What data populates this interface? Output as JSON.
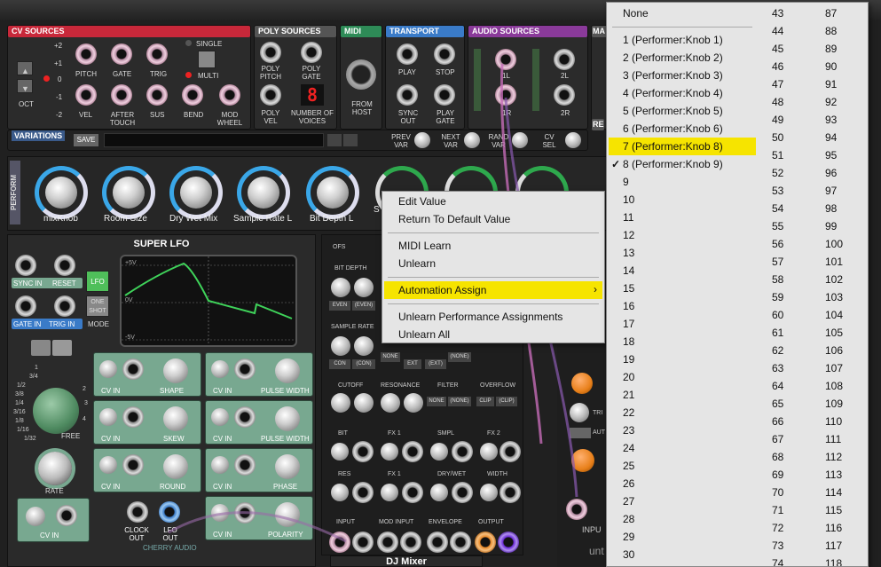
{
  "cv_sources": {
    "title": "CV SOURCES",
    "oct_label": "OCT",
    "oct_values": [
      "+2",
      "+1",
      "0",
      "-1",
      "-2"
    ],
    "jacks": [
      "PITCH",
      "GATE",
      "TRIG",
      "VEL",
      "AFTER TOUCH",
      "SUS",
      "BEND",
      "MOD WHEEL"
    ],
    "single": "SINGLE",
    "multi": "MULTI"
  },
  "poly_sources": {
    "title": "POLY SOURCES",
    "jacks": [
      "POLY PITCH",
      "POLY GATE",
      "POLY VEL",
      "NUMBER OF VOICES"
    ],
    "digit": "8"
  },
  "midi": {
    "title": "MIDI",
    "from_host": "FROM HOST"
  },
  "transport": {
    "title": "TRANSPORT",
    "jacks": [
      "PLAY",
      "STOP",
      "SYNC OUT",
      "PLAY GATE"
    ]
  },
  "audio_sources": {
    "title": "AUDIO SOURCES",
    "jacks": [
      "1L",
      "2L",
      "1R",
      "2R"
    ]
  },
  "ma_title": "MA",
  "re_title": "RE",
  "variations": {
    "title": "VARIATIONS",
    "save": "SAVE",
    "buttons": [
      "PREV VAR",
      "NEXT VAR",
      "RAND VAR",
      "CV SEL"
    ]
  },
  "perform": {
    "title": "PERFORM",
    "knobs": [
      "mixKnob",
      "Room Size",
      "Dry Wet Mix",
      "Sample Rate L",
      "Bit Depth L",
      "S"
    ]
  },
  "lfo": {
    "title": "SUPER LFO",
    "sync_in": "SYNC IN",
    "reset": "RESET",
    "lfo": "LFO",
    "one_shot": "ONE SHOT",
    "gate_in": "GATE IN",
    "trig_in": "TRIG IN",
    "mode": "MODE",
    "scope_labels": [
      "+5V",
      "0V",
      "-5V"
    ],
    "rate_scale": [
      "1",
      "3/4",
      "1/2",
      "3/8",
      "1/4",
      "3/16",
      "1/8",
      "1/16",
      "1/32",
      "2",
      "3",
      "4"
    ],
    "free": "FREE",
    "rate": "RATE",
    "cv_in": "CV IN",
    "modules": [
      "SHAPE",
      "PULSE WIDTH",
      "SKEW",
      "PHASE",
      "ROUND",
      "POLARITY"
    ],
    "clock_out": "CLOCK OUT",
    "lfo_out": "LFO OUT",
    "brand": "CHERRY AUDIO"
  },
  "fx": {
    "ofs": "OFS",
    "bit_depth": "BIT DEPTH",
    "even": [
      "EVEN",
      "(EVEN)"
    ],
    "sample_rate": "SAMPLE RATE",
    "con": [
      "CON",
      "(CON)"
    ],
    "ext": [
      "NONE",
      "EXT",
      "(EXT)",
      "(NONE)"
    ],
    "cutoff": "CUTOFF",
    "resonance": "RESONANCE",
    "filter": "FILTER",
    "overflow": "OVERFLOW",
    "filter_opts": [
      "NONE",
      "(NONE)"
    ],
    "overflow_opts": [
      "CLIP",
      "(CLIP)"
    ],
    "row1": [
      "BIT",
      "FX 1",
      "SMPL",
      "FX 2"
    ],
    "row2": [
      "RES",
      "FX 1",
      "DRY/WET",
      "WIDTH"
    ],
    "io": [
      "INPUT",
      "MOD INPUT",
      "ENVELOPE",
      "OUTPUT"
    ]
  },
  "dj_mixer": "DJ Mixer",
  "right_partial": {
    "trig": "TRI",
    "aut": "AUT",
    "input": "INPU",
    "unt": "unt"
  },
  "context_menu": {
    "items": [
      "Edit Value",
      "Return To Default Value",
      "MIDI Learn",
      "Unlearn",
      "Automation Assign",
      "Unlearn Performance Assignments",
      "Unlearn All"
    ],
    "highlighted": "Automation Assign"
  },
  "submenu": {
    "none": "None",
    "performer": [
      "1 (Performer:Knob 1)",
      "2 (Performer:Knob 2)",
      "3 (Performer:Knob 3)",
      "4 (Performer:Knob 4)",
      "5 (Performer:Knob 5)",
      "6 (Performer:Knob 6)",
      "7 (Performer:Knob 8)",
      "8 (Performer:Knob 9)"
    ],
    "highlighted_index": 6,
    "checked_index": 7,
    "checkmark": "✓",
    "col1": [
      "9",
      "10",
      "11",
      "12",
      "13",
      "14",
      "15",
      "16",
      "17",
      "18",
      "19",
      "20",
      "21",
      "22",
      "23",
      "24",
      "25",
      "26",
      "27",
      "28",
      "29",
      "30"
    ],
    "col2": [
      "43",
      "44",
      "45",
      "46",
      "47",
      "48",
      "49",
      "50",
      "51",
      "52",
      "53",
      "54",
      "55",
      "56",
      "57",
      "58",
      "59",
      "60",
      "61",
      "62",
      "63",
      "64",
      "65",
      "66",
      "67",
      "68",
      "69",
      "70",
      "71",
      "72",
      "73",
      "74"
    ],
    "col3": [
      "87",
      "88",
      "89",
      "90",
      "91",
      "92",
      "93",
      "94",
      "95",
      "96",
      "97",
      "98",
      "99",
      "100",
      "101",
      "102",
      "103",
      "104",
      "105",
      "106",
      "107",
      "108",
      "109",
      "110",
      "111",
      "112",
      "113",
      "114",
      "115",
      "116",
      "117",
      "118"
    ]
  },
  "colors": {
    "highlight": "#f6e400",
    "cv_title": "#c8283a",
    "poly_title": "#555",
    "midi_title": "#2e8b57",
    "transport_title": "#3a7bc8",
    "audio_title": "#8a3a9a",
    "lfo_green": "#78a890"
  }
}
